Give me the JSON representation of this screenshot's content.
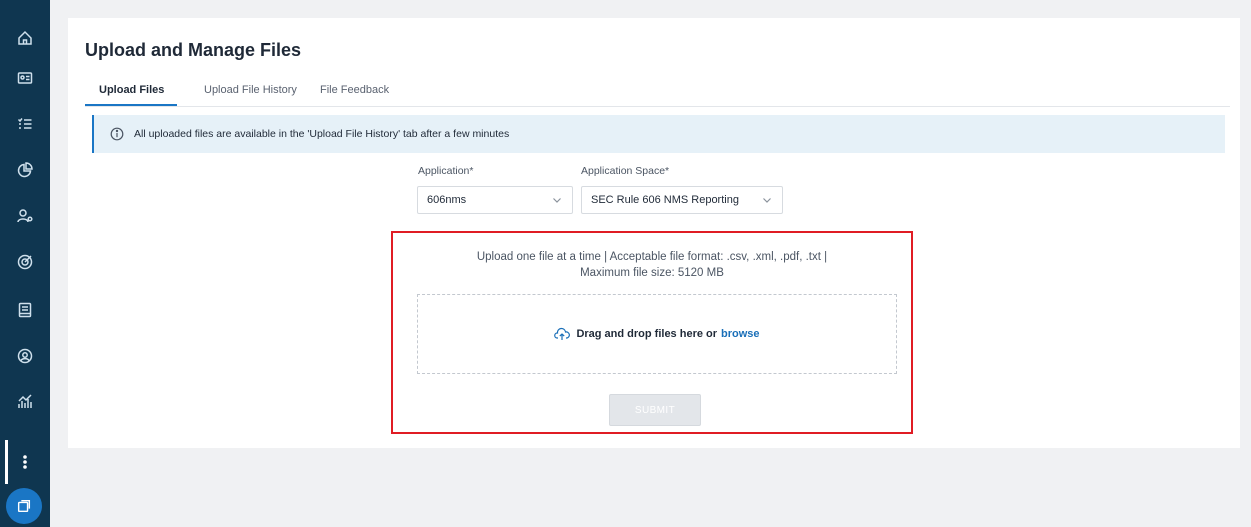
{
  "sidebar": {
    "items": [
      {
        "icon": "home-icon"
      },
      {
        "icon": "id-card-icon"
      },
      {
        "icon": "checklist-icon"
      },
      {
        "icon": "pie-chart-icon"
      },
      {
        "icon": "user-settings-icon"
      },
      {
        "icon": "target-icon"
      },
      {
        "icon": "book-icon"
      },
      {
        "icon": "user-circle-icon"
      },
      {
        "icon": "analytics-icon"
      },
      {
        "icon": "more-vertical-icon"
      }
    ],
    "bottom_icon": "windows-icon",
    "colors": {
      "background": "#0f3650",
      "accent": "#1a76c5"
    }
  },
  "page": {
    "title": "Upload and Manage Files"
  },
  "tabs": [
    {
      "label": "Upload Files",
      "active": true
    },
    {
      "label": "Upload File History",
      "active": false
    },
    {
      "label": "File Feedback",
      "active": false
    }
  ],
  "banner": {
    "icon": "info-icon",
    "text": "All uploaded files are available in the 'Upload File History' tab after a few minutes"
  },
  "form": {
    "application": {
      "label": "Application*",
      "value": "606nms"
    },
    "application_space": {
      "label": "Application Space*",
      "value": "SEC Rule 606 NMS Reporting"
    }
  },
  "upload": {
    "info_line1": "Upload one file at a time | Acceptable file format: .csv, .xml, .pdf, .txt |",
    "info_line2": "Maximum file size: 5120 MB",
    "drop_text": "Drag and drop files here or",
    "browse_label": "browse",
    "submit_label": "SUBMIT",
    "highlight_color": "#e01c24"
  }
}
